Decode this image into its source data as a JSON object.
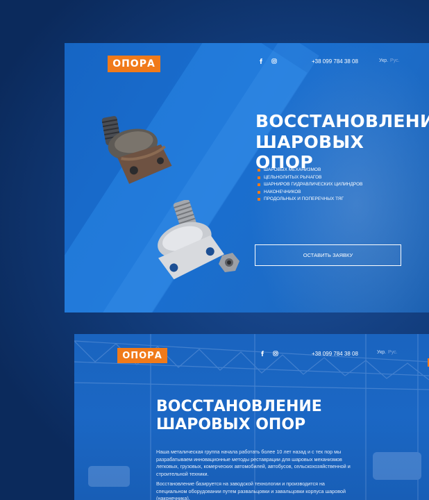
{
  "colors": {
    "accent": "#f07a1a",
    "primary_blue": "#1a6fd0",
    "background": "#0d2f66"
  },
  "screen1": {
    "logo": "ОПОРА",
    "social": [
      {
        "icon": "facebook-icon",
        "glyph": "f"
      },
      {
        "icon": "instagram-icon",
        "glyph": ""
      }
    ],
    "phone": "+38 099 784 38 08",
    "lang": {
      "ukr": "Укр.",
      "rus": "Рус."
    },
    "title_line1": "ВОССТАНОВЛЕНИЕ",
    "title_line2": "ШАРОВЫХ ОПОР",
    "bullets": [
      "ШАРОВЫХ МЕХАНИЗМОВ",
      "ЦЕЛЬНОЛИТЫХ РЫЧАГОВ",
      "ШАРНИРОВ ГИДРАВЛИЧЕСКИХ ЦИЛИНДРОВ",
      "НАКОНЕЧНИКОВ",
      "ПРОДОЛЬНЫХ И ПОПЕРЕЧНЫХ ТЯГ"
    ],
    "cta": "ОСТАВИТЬ ЗАЯВКУ"
  },
  "screen2": {
    "logo": "ОПОРА",
    "phone": "+38 099 784 38 08",
    "lang": {
      "ukr": "Укр.",
      "rus": "Рус."
    },
    "title_line1": "ВОССТАНОВЛЕНИЕ",
    "title_line2": "ШАРОВЫХ ОПОР",
    "para1": "Наша металическая группа начала работать более 10 лет назад  и с тех пор мы разрабатываем инновационные методы реставрации для шаровых механизмов легковых, грузовых, комерческих автомобилей, автобусов, сельскохозяйственной и строительной техники.",
    "para2": "Восстановление  базируется на заводской технологии и производится на специальном оборудовании путем развальцовки и завальцовки корпуса шаровой (наконечника)."
  }
}
